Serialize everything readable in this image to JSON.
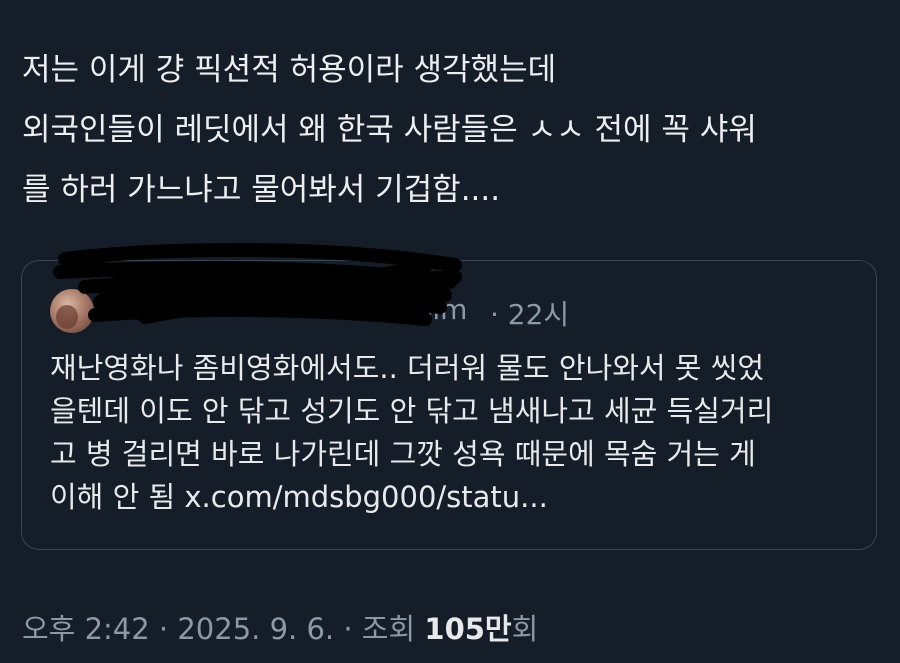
{
  "post": {
    "lines": [
      "저는 이게 걍 픽션적 허용이라 생각했는데",
      "외국인들이 레딧에서 왜 한국 사람들은 ㅅㅅ 전에 꼭 샤워",
      "를 하러 가느냐고 물어봐서 기겁함...."
    ]
  },
  "quote": {
    "handle_tail": "nsim",
    "time_ago": "· 22시",
    "lines": [
      "재난영화나 좀비영화에서도.. 더러워 물도 안나와서 못 씻었",
      "을텐데 이도 안 닦고 성기도 안 닦고 냄새나고 세균 득실거리",
      "고 병 걸리면 바로 나가린데 그깟 성욕 때문에 목숨 거는 게",
      "이해 안 됨 x.com/mdsbg000/statu..."
    ]
  },
  "meta": {
    "timestamp": "오후 2:42 · 2025. 9. 6. · 조회 ",
    "views_count": "105만",
    "views_suffix": "회"
  },
  "colors": {
    "background": "#151d28",
    "text": "#e7e9ea",
    "secondary_text": "#8b98a5",
    "card_border": "#3a4552",
    "redaction": "#000000"
  }
}
